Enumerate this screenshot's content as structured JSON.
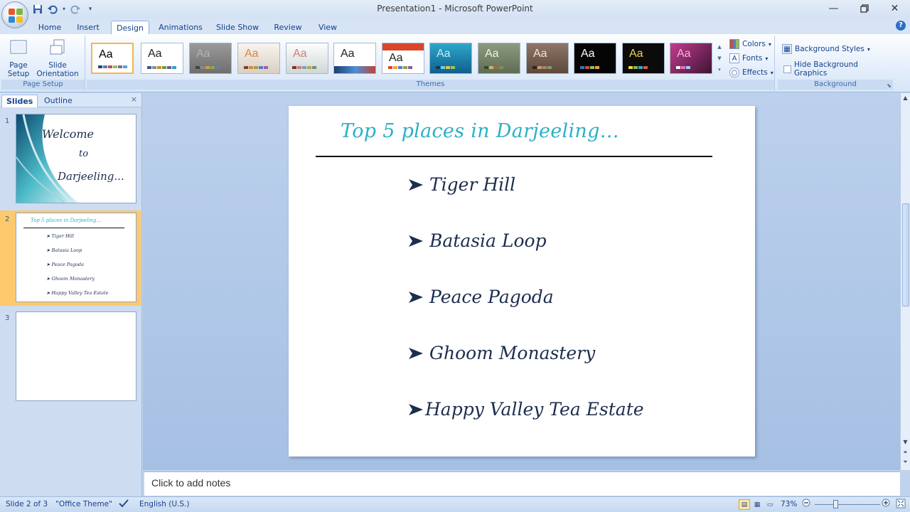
{
  "window": {
    "title": "Presentation1 - Microsoft PowerPoint"
  },
  "qat": {
    "items": [
      "save-icon",
      "undo-icon",
      "undo-dropdown-icon",
      "redo-icon",
      "customize-icon"
    ]
  },
  "tabs": [
    {
      "label": "Home",
      "active": false
    },
    {
      "label": "Insert",
      "active": false
    },
    {
      "label": "Design",
      "active": true
    },
    {
      "label": "Animations",
      "active": false
    },
    {
      "label": "Slide Show",
      "active": false
    },
    {
      "label": "Review",
      "active": false
    },
    {
      "label": "View",
      "active": false
    }
  ],
  "ribbon": {
    "page_setup": {
      "group_label": "Page Setup",
      "page_setup_btn": "Page Setup",
      "page_setup_line1": "Page",
      "page_setup_line2": "Setup",
      "orientation_line1": "Slide",
      "orientation_line2": "Orientation",
      "orientation_dropdown": "▾"
    },
    "themes": {
      "group_label": "Themes",
      "sample": "Aa"
    },
    "background": {
      "group_label": "Background",
      "colors": "Colors",
      "fonts": "Fonts",
      "effects": "Effects",
      "background_styles": "Background Styles",
      "hide_background_graphics": "Hide Background Graphics"
    }
  },
  "left_pane": {
    "tab_slides": "Slides",
    "tab_outline": "Outline",
    "close": "×",
    "slides": [
      {
        "number": "1",
        "title_lines": [
          "Welcome",
          "to",
          "Darjeeling..."
        ]
      },
      {
        "number": "2",
        "title": "Top 5 places in Darjeeling...",
        "bullets": [
          "Tiger Hill",
          "Batasia Loop",
          "Peace Pagoda",
          "Ghoom Monastery",
          "Happy Valley Tea Estate"
        ]
      },
      {
        "number": "3"
      }
    ],
    "selected_slide": 2
  },
  "slide": {
    "title": "Top 5 places in Darjeeling…",
    "bullets": [
      "Tiger Hill",
      "Batasia Loop",
      "Peace Pagoda",
      "Ghoom Monastery",
      "Happy Valley Tea Estate"
    ]
  },
  "notes": {
    "placeholder": "Click to add notes"
  },
  "status": {
    "slide_counter": "Slide 2 of 3",
    "theme_name": "\"Office Theme\"",
    "language": "English (U.S.)",
    "zoom": "73%"
  },
  "colors": {
    "title_accent": "#2bb0c7",
    "ribbon_text": "#15428b",
    "selection": "#fcc96c"
  }
}
